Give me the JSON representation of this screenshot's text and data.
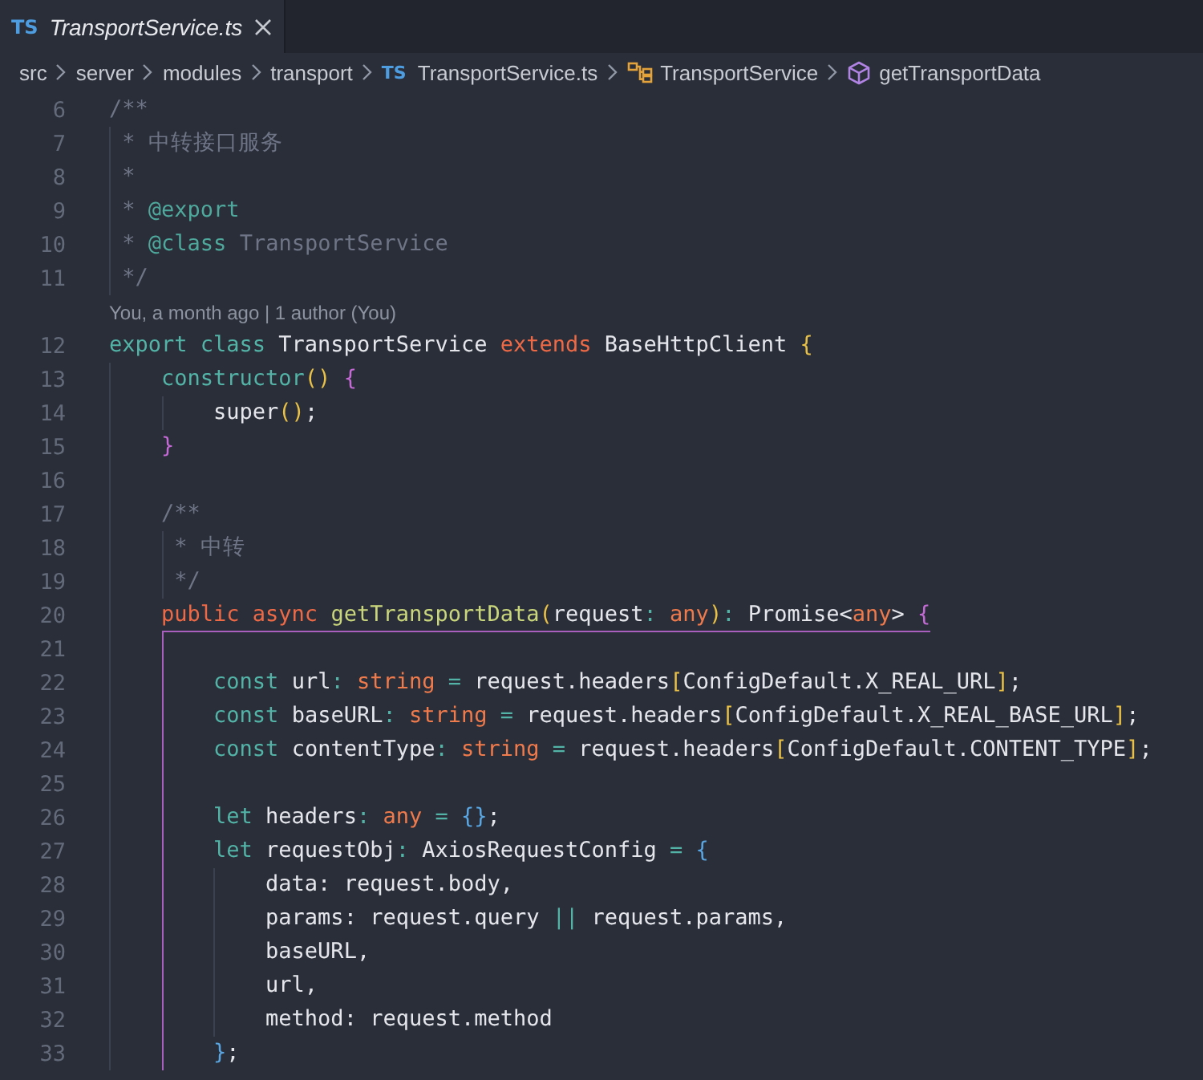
{
  "tabs": [
    {
      "file_type": "TS",
      "title": "TransportService.ts",
      "selected": true
    }
  ],
  "breadcrumb": [
    {
      "kind": "folder",
      "label": "src"
    },
    {
      "kind": "folder",
      "label": "server"
    },
    {
      "kind": "folder",
      "label": "modules"
    },
    {
      "kind": "folder",
      "label": "transport"
    },
    {
      "kind": "file",
      "file_type": "TS",
      "label": "TransportService.ts"
    },
    {
      "kind": "class",
      "label": "TransportService"
    },
    {
      "kind": "method",
      "label": "getTransportData"
    }
  ],
  "lines": [
    {
      "kind": "code",
      "number": "6",
      "tokens": [
        {
          "kind": "comment",
          "text": "/**"
        }
      ]
    },
    {
      "kind": "code",
      "number": "7",
      "tokens": [
        {
          "kind": "comment",
          "text": " * 中转接口服务"
        }
      ]
    },
    {
      "kind": "code",
      "number": "8",
      "tokens": [
        {
          "kind": "comment",
          "text": " *"
        }
      ]
    },
    {
      "kind": "code",
      "number": "9",
      "tokens": [
        {
          "kind": "comment",
          "text": " * "
        },
        {
          "kind": "tag",
          "text": "@export"
        }
      ]
    },
    {
      "kind": "code",
      "number": "10",
      "tokens": [
        {
          "kind": "comment",
          "text": " * "
        },
        {
          "kind": "tag",
          "text": "@class"
        },
        {
          "kind": "comment",
          "text": " TransportService"
        }
      ]
    },
    {
      "kind": "code",
      "number": "11",
      "tokens": [
        {
          "kind": "comment",
          "text": " */"
        }
      ]
    },
    {
      "kind": "codelens",
      "text": "You, a month ago | 1 author (You)"
    },
    {
      "kind": "code",
      "number": "12",
      "tokens": [
        {
          "kind": "keyword",
          "text": "export class "
        },
        {
          "kind": "plain",
          "text": "TransportService "
        },
        {
          "kind": "modifier",
          "text": "extends "
        },
        {
          "kind": "plain",
          "text": "BaseHttpClient "
        },
        {
          "kind": "bracket1",
          "text": "{"
        }
      ]
    },
    {
      "kind": "code",
      "number": "13",
      "tokens": [
        {
          "kind": "keyword",
          "text": "    constructor"
        },
        {
          "kind": "bracket1",
          "text": "() "
        },
        {
          "kind": "bracket2",
          "text": "{"
        }
      ]
    },
    {
      "kind": "code",
      "number": "14",
      "tokens": [
        {
          "kind": "plain",
          "text": "        super"
        },
        {
          "kind": "bracket1",
          "text": "()"
        },
        {
          "kind": "plain",
          "text": ";"
        }
      ]
    },
    {
      "kind": "code",
      "number": "15",
      "tokens": [
        {
          "kind": "bracket2",
          "text": "    }"
        }
      ]
    },
    {
      "kind": "code",
      "number": "16"
    },
    {
      "kind": "code",
      "number": "17",
      "tokens": [
        {
          "kind": "comment",
          "text": "    /**"
        }
      ]
    },
    {
      "kind": "code",
      "number": "18",
      "tokens": [
        {
          "kind": "comment",
          "text": "     * 中转"
        }
      ]
    },
    {
      "kind": "code",
      "number": "19",
      "tokens": [
        {
          "kind": "comment",
          "text": "     */"
        }
      ]
    },
    {
      "kind": "code",
      "number": "20",
      "bracket_highlight": true,
      "tokens": [
        {
          "kind": "modifier",
          "text": "    public async "
        },
        {
          "kind": "function",
          "text": "getTransportData"
        },
        {
          "kind": "bracket1",
          "text": "("
        },
        {
          "kind": "plain",
          "text": "request"
        },
        {
          "kind": "operator",
          "text": ": "
        },
        {
          "kind": "type",
          "text": "any"
        },
        {
          "kind": "bracket1",
          "text": ")"
        },
        {
          "kind": "operator",
          "text": ": "
        },
        {
          "kind": "plain",
          "text": "Promise<"
        },
        {
          "kind": "type",
          "text": "any"
        },
        {
          "kind": "plain",
          "text": "> "
        },
        {
          "kind": "bracket2",
          "text": "{"
        }
      ],
      "children": [
        {
          "kind": "code",
          "number": "21"
        },
        {
          "kind": "code",
          "number": "22",
          "tokens": [
            {
              "kind": "keyword",
              "text": "        const "
            },
            {
              "kind": "plain",
              "text": "url"
            },
            {
              "kind": "operator",
              "text": ": "
            },
            {
              "kind": "type",
              "text": "string"
            },
            {
              "kind": "operator",
              "text": " = "
            },
            {
              "kind": "plain",
              "text": "request.headers"
            },
            {
              "kind": "bracket1",
              "text": "["
            },
            {
              "kind": "plain",
              "text": "ConfigDefault.X_REAL_URL"
            },
            {
              "kind": "bracket1",
              "text": "]"
            },
            {
              "kind": "plain",
              "text": ";"
            }
          ]
        },
        {
          "kind": "code",
          "number": "23",
          "tokens": [
            {
              "kind": "keyword",
              "text": "        const "
            },
            {
              "kind": "plain",
              "text": "baseURL"
            },
            {
              "kind": "operator",
              "text": ": "
            },
            {
              "kind": "type",
              "text": "string"
            },
            {
              "kind": "operator",
              "text": " = "
            },
            {
              "kind": "plain",
              "text": "request.headers"
            },
            {
              "kind": "bracket1",
              "text": "["
            },
            {
              "kind": "plain",
              "text": "ConfigDefault.X_REAL_BASE_URL"
            },
            {
              "kind": "bracket1",
              "text": "]"
            },
            {
              "kind": "plain",
              "text": ";"
            }
          ]
        },
        {
          "kind": "code",
          "number": "24",
          "tokens": [
            {
              "kind": "keyword",
              "text": "        const "
            },
            {
              "kind": "plain",
              "text": "contentType"
            },
            {
              "kind": "operator",
              "text": ": "
            },
            {
              "kind": "type",
              "text": "string"
            },
            {
              "kind": "operator",
              "text": " = "
            },
            {
              "kind": "plain",
              "text": "request.headers"
            },
            {
              "kind": "bracket1",
              "text": "["
            },
            {
              "kind": "plain",
              "text": "ConfigDefault.CONTENT_TYPE"
            },
            {
              "kind": "bracket1",
              "text": "]"
            },
            {
              "kind": "plain",
              "text": ";"
            }
          ]
        },
        {
          "kind": "code",
          "number": "25"
        },
        {
          "kind": "code",
          "number": "26",
          "tokens": [
            {
              "kind": "keyword",
              "text": "        let "
            },
            {
              "kind": "plain",
              "text": "headers"
            },
            {
              "kind": "operator",
              "text": ": "
            },
            {
              "kind": "type",
              "text": "any"
            },
            {
              "kind": "operator",
              "text": " = "
            },
            {
              "kind": "bracket3",
              "text": "{}"
            },
            {
              "kind": "plain",
              "text": ";"
            }
          ]
        },
        {
          "kind": "code",
          "number": "27",
          "tokens": [
            {
              "kind": "keyword",
              "text": "        let "
            },
            {
              "kind": "plain",
              "text": "requestObj"
            },
            {
              "kind": "operator",
              "text": ": "
            },
            {
              "kind": "plain",
              "text": "AxiosRequestConfig"
            },
            {
              "kind": "operator",
              "text": " = "
            },
            {
              "kind": "bracket3",
              "text": "{"
            }
          ]
        },
        {
          "kind": "code",
          "number": "28",
          "tokens": [
            {
              "kind": "plain",
              "text": "            data: request.body,"
            }
          ]
        },
        {
          "kind": "code",
          "number": "29",
          "tokens": [
            {
              "kind": "plain",
              "text": "            params: request.query "
            },
            {
              "kind": "operator",
              "text": "||"
            },
            {
              "kind": "plain",
              "text": " request.params,"
            }
          ]
        },
        {
          "kind": "code",
          "number": "30",
          "tokens": [
            {
              "kind": "plain",
              "text": "            baseURL,"
            }
          ]
        },
        {
          "kind": "code",
          "number": "31",
          "tokens": [
            {
              "kind": "plain",
              "text": "            url,"
            }
          ]
        },
        {
          "kind": "code",
          "number": "32",
          "tokens": [
            {
              "kind": "plain",
              "text": "            method: request.method"
            }
          ]
        },
        {
          "kind": "code",
          "number": "33",
          "tokens": [
            {
              "kind": "bracket3",
              "text": "        }"
            },
            {
              "kind": "plain",
              "text": ";"
            }
          ]
        }
      ]
    }
  ]
}
